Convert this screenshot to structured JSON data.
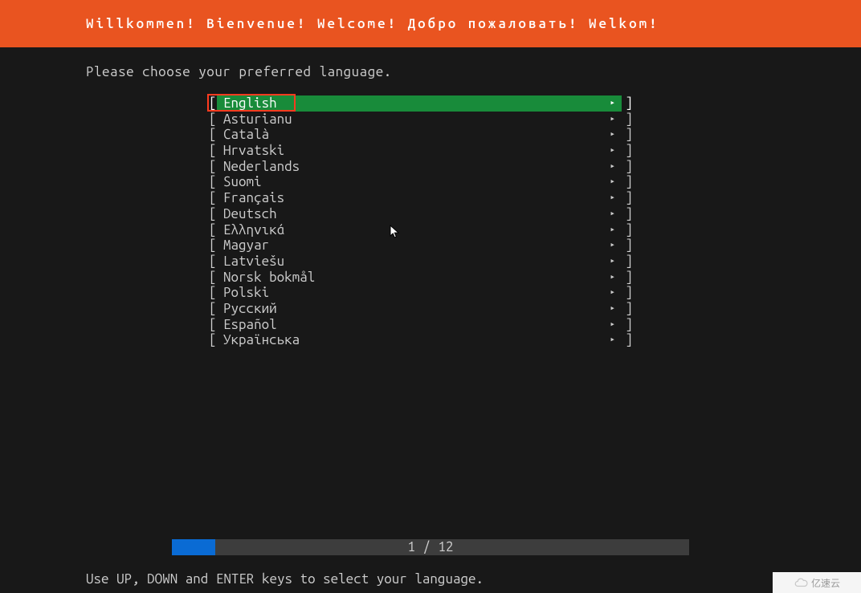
{
  "header": {
    "title": "Willkommen! Bienvenue! Welcome! Добро пожаловать! Welkom!"
  },
  "prompt": "Please choose your preferred language.",
  "languages": [
    {
      "label": "English",
      "selected": true
    },
    {
      "label": "Asturianu",
      "selected": false
    },
    {
      "label": "Català",
      "selected": false
    },
    {
      "label": "Hrvatski",
      "selected": false
    },
    {
      "label": "Nederlands",
      "selected": false
    },
    {
      "label": "Suomi",
      "selected": false
    },
    {
      "label": "Français",
      "selected": false
    },
    {
      "label": "Deutsch",
      "selected": false
    },
    {
      "label": "Ελληνικά",
      "selected": false
    },
    {
      "label": "Magyar",
      "selected": false
    },
    {
      "label": "Latviešu",
      "selected": false
    },
    {
      "label": "Norsk bokmål",
      "selected": false
    },
    {
      "label": "Polski",
      "selected": false
    },
    {
      "label": "Русский",
      "selected": false
    },
    {
      "label": "Español",
      "selected": false
    },
    {
      "label": "Українська",
      "selected": false
    }
  ],
  "brackets": {
    "left": "[ ",
    "right": "]"
  },
  "arrow_glyph": "▸",
  "progress": {
    "current": 1,
    "total": 12,
    "text": "1 / 12"
  },
  "footer_hint": "Use UP, DOWN and ENTER keys to select your language.",
  "watermark": "亿速云",
  "colors": {
    "header_bg": "#e95420",
    "selected_bg": "#188b3a",
    "highlight_border": "#ff3b1f",
    "progress_fill": "#0a6bd4",
    "progress_track": "#3d3d3d",
    "page_bg": "#181818"
  }
}
